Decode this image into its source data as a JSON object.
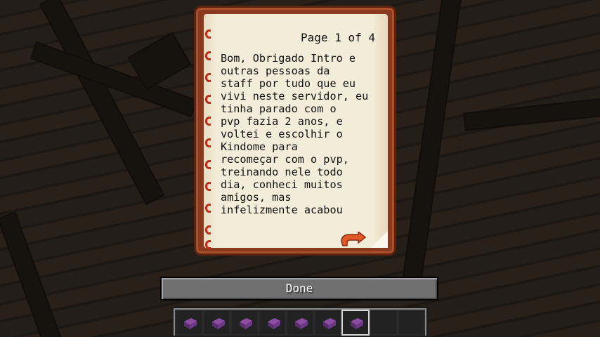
{
  "book": {
    "page_indicator": "Page 1 of 4",
    "text": "Bom, Obrigado Intro e\noutras pessoas da\nstaff por tudo que eu\nvivi neste servidor, eu\ntinha parado com o\npvp fazia 2 anos, e\nvoltei e escolhir o\nKindome para\nrecomeçar com o pvp,\ntreinando nele todo\ndia, conheci muitos\namigos, mas\ninfelizmente acabou"
  },
  "done_button": {
    "label": "Done"
  },
  "hotbar": {
    "slots": [
      {
        "item": "enchanted-book-icon"
      },
      {
        "item": "enchanted-book-icon"
      },
      {
        "item": "enchanted-book-icon"
      },
      {
        "item": "enchanted-book-icon"
      },
      {
        "item": "enchanted-book-icon"
      },
      {
        "item": "enchanted-book-icon"
      },
      {
        "item": "enchanted-book-icon",
        "selected": true
      },
      {
        "item": ""
      },
      {
        "item": ""
      }
    ]
  },
  "colors": {
    "book_cover": "#8a3a1e",
    "page": "#f1e9d3",
    "arrow": "#e0582a",
    "button": "#6f6f6f"
  }
}
